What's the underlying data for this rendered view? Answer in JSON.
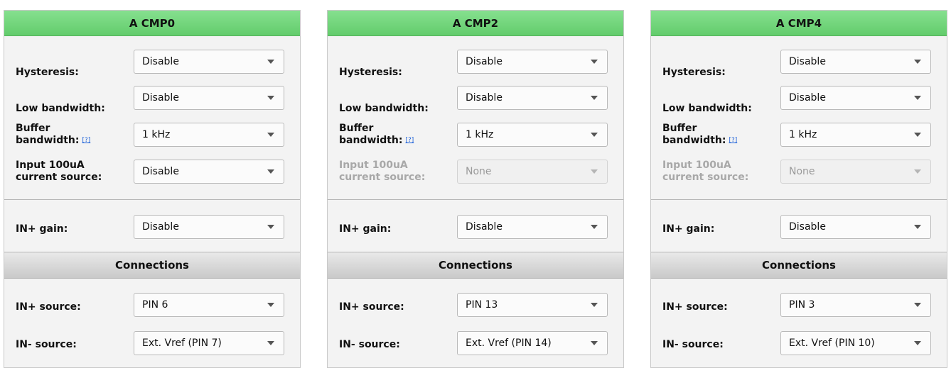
{
  "panels": [
    {
      "title": "A CMP0",
      "hysteresis": {
        "label": "Hysteresis:",
        "value": "Disable"
      },
      "low_bandwidth": {
        "label": "Low bandwidth:",
        "value": "Disable"
      },
      "buffer_bandwidth": {
        "label_line1": "Buffer",
        "label_line2": "bandwidth:",
        "help": "[?]",
        "value": "1 kHz"
      },
      "input_current": {
        "label_line1": "Input 100uA",
        "label_line2": "current source:",
        "value": "Disable",
        "enabled": true
      },
      "in_plus_gain": {
        "label": "IN+ gain:",
        "value": "Disable"
      },
      "connections_title": "Connections",
      "in_plus_source": {
        "label": "IN+ source:",
        "value": "PIN 6"
      },
      "in_minus_source": {
        "label": "IN- source:",
        "value": "Ext. Vref (PIN 7)"
      }
    },
    {
      "title": "A CMP2",
      "hysteresis": {
        "label": "Hysteresis:",
        "value": "Disable"
      },
      "low_bandwidth": {
        "label": "Low bandwidth:",
        "value": "Disable"
      },
      "buffer_bandwidth": {
        "label_line1": "Buffer",
        "label_line2": "bandwidth:",
        "help": "[?]",
        "value": "1 kHz"
      },
      "input_current": {
        "label_line1": "Input 100uA",
        "label_line2": "current source:",
        "value": "None",
        "enabled": false
      },
      "in_plus_gain": {
        "label": "IN+ gain:",
        "value": "Disable"
      },
      "connections_title": "Connections",
      "in_plus_source": {
        "label": "IN+ source:",
        "value": "PIN 13"
      },
      "in_minus_source": {
        "label": "IN- source:",
        "value": "Ext. Vref (PIN 14)"
      }
    },
    {
      "title": "A CMP4",
      "hysteresis": {
        "label": "Hysteresis:",
        "value": "Disable"
      },
      "low_bandwidth": {
        "label": "Low bandwidth:",
        "value": "Disable"
      },
      "buffer_bandwidth": {
        "label_line1": "Buffer",
        "label_line2": "bandwidth:",
        "help": "[?]",
        "value": "1 kHz"
      },
      "input_current": {
        "label_line1": "Input 100uA",
        "label_line2": "current source:",
        "value": "None",
        "enabled": false
      },
      "in_plus_gain": {
        "label": "IN+ gain:",
        "value": "Disable"
      },
      "connections_title": "Connections",
      "in_plus_source": {
        "label": "IN+ source:",
        "value": "PIN 3"
      },
      "in_minus_source": {
        "label": "IN- source:",
        "value": "Ext. Vref (PIN 10)"
      }
    }
  ]
}
